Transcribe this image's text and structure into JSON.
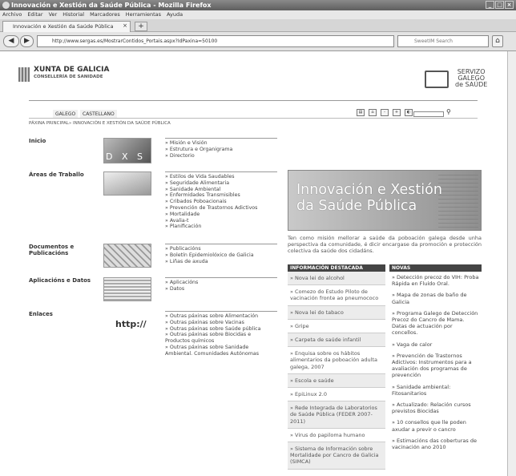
{
  "window": {
    "title": "Innovación e Xestión da Saúde Pública - Mozilla Firefox",
    "controls": [
      "_",
      "□",
      "×"
    ]
  },
  "menu": [
    "Archivo",
    "Editar",
    "Ver",
    "Historial",
    "Marcadores",
    "Herramientas",
    "Ayuda"
  ],
  "tab": {
    "label": "Innovación e Xestión da Saúde Pública",
    "close": "×",
    "new": "+"
  },
  "nav": {
    "url": "http://www.sergas.es/MostrarContidos_Portais.aspx?IdPaxina=50100",
    "search_placeholder": "SweetIM Search"
  },
  "header": {
    "xunta_title": "XUNTA DE GALICIA",
    "xunta_sub": "CONSELLERÍA DE SANIDADE",
    "sergas_lines": [
      "SERVIZO",
      "GALEGO",
      "de SAÚDE"
    ]
  },
  "lang": [
    "GALEGO",
    "CASTELLANO"
  ],
  "breadcrumb": "PÁXINA PRINCIPAL» INNOVACIÓN E XESTIÓN DA SAÚDE PÚBLICA",
  "sections": [
    {
      "title": "Inicio",
      "image_text": "D X S P",
      "links": [
        "» Misión e Visión",
        "» Estrutura e Organigrama",
        "» Directorio"
      ]
    },
    {
      "title": "Áreas de Traballo",
      "links": [
        "» Estilos de Vida Saudables",
        "» Seguridade Alimentaria",
        "» Sanidade Ambiental",
        "» Enfermidades Transmisibles",
        "» Cribados Poboacionais",
        "» Prevención de Trastornos Adictivos",
        "» Mortalidade",
        "» Avalia-t",
        "» Planificación"
      ]
    },
    {
      "title": "Documentos e Publicacións",
      "links": [
        "» Publicacións",
        "» Boletín Epidemiolóxico de Galicia",
        "» Liñas de axuda"
      ]
    },
    {
      "title": "Aplicacións e Datos",
      "links": [
        "» Aplicacións",
        "» Datos"
      ]
    },
    {
      "title": "Enlaces",
      "image_text": "http://",
      "links": [
        "» Outras páxinas sobre Alimentación",
        "» Outras páxinas sobre Vacinas",
        "» Outras páxinas sobre Saúde pública",
        "» Outras páxinas sobre Biocidas e",
        "   Productos químicos",
        "» Outras páxinas sobre Sanidade",
        "   Ambiental. Comunidades Autónomas"
      ]
    }
  ],
  "banner": {
    "line1": "Innovación e Xestión",
    "line2": "da Saúde Pública"
  },
  "intro": "Ten como misión mellorar a saúde da poboación galega desde unha perspectiva da comunidade, é dicir encargase da promoción e protección colectiva da saúde dos cidadáns.",
  "featured": {
    "heading": "INFORMACIÓN DESTACADA",
    "items": [
      "» Nova lei do alcohol",
      "» Comezo do Estudo Piloto de vacinación fronte ao pneumococo",
      "» Nova lei do tabaco",
      "» Gripe",
      "» Carpeta de saúde infantil",
      "» Enquisa sobre os hábitos alimentarios da poboación adulta galega, 2007",
      "» Escola e saúde",
      "» EpiLinux 2.0",
      "» Rede Integrada de Laboratorios de Saúde Pública (FEDER 2007-2011)",
      "» Virus do papiloma humano",
      "» Sistema de Información sobre Mortalidade por Cancro de Galicia (SIMCA)"
    ]
  },
  "news": {
    "heading": "NOVAS",
    "items": [
      "» Detección precoz do VIH: Proba Rápida en Fluído Oral.",
      "» Mapa de zonas de baño de Galicia",
      "» Programa Galego de Detección Precoz do Cancro de Mama. Datas de actuación por concellos.",
      "» Vaga de calor",
      "» Prevención de Trastornos Adictivos: Instrumentos para a avaliación dos programas de prevención",
      "» Sanidade ambiental: Fitosanitarios",
      "» Actualizado: Relación cursos previstos Biocidas",
      "» 10 consellos que lle poden axudar a previr o cancro",
      "» Estimacións das coberturas de vacinación ano 2010"
    ]
  }
}
